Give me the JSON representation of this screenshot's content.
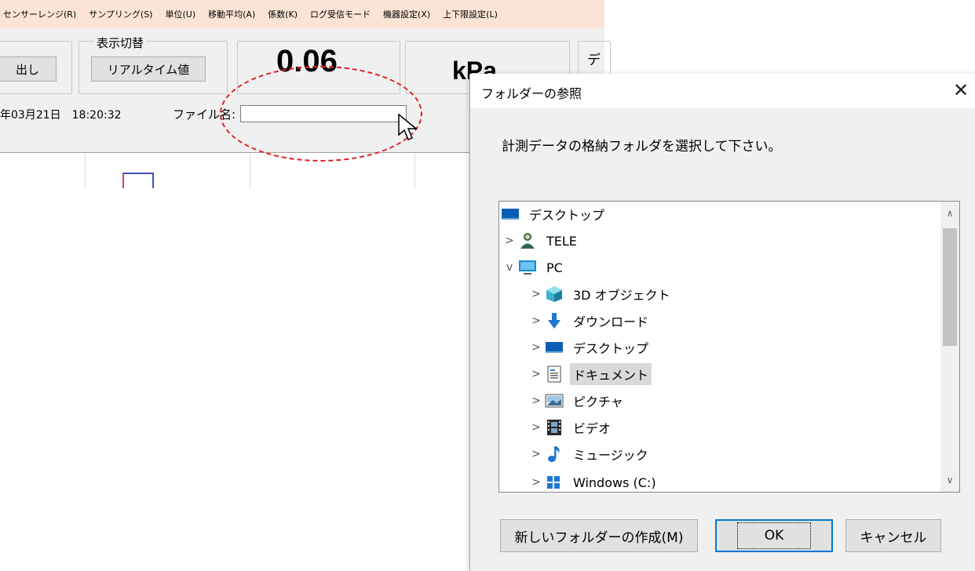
{
  "menu": [
    "センサーレンジ(R)",
    "サンプリング(S)",
    "単位(U)",
    "移動平均(A)",
    "係数(K)",
    "ログ受信モード",
    "機器設定(X)",
    "上下限設定(L)"
  ],
  "panel": {
    "read_button": "出し",
    "display_switch_label": "表示切替",
    "realtime_button": "リアルタイム値",
    "value": "0.06",
    "unit": "kPa",
    "side_label": "デ",
    "datetime": "年03月21日　18:20:32",
    "filename_label": "ファイル名:",
    "filename_value": ""
  },
  "dialog": {
    "title": "フォルダーの参照",
    "instruction": "計測データの格納フォルダを選択して下さい。",
    "tree": [
      {
        "label": "デスクトップ",
        "icon": "desktop-icon",
        "level": 0,
        "chevron": ""
      },
      {
        "label": "TELE",
        "icon": "user-icon",
        "level": 1,
        "chevron": ">"
      },
      {
        "label": "PC",
        "icon": "computer-icon",
        "level": 1,
        "chevron": "v"
      },
      {
        "label": "3D オブジェクト",
        "icon": "cube-icon",
        "level": 2,
        "chevron": ">"
      },
      {
        "label": "ダウンロード",
        "icon": "download-arrow-icon",
        "level": 2,
        "chevron": ">"
      },
      {
        "label": "デスクトップ",
        "icon": "desktop-icon",
        "level": 2,
        "chevron": ">"
      },
      {
        "label": "ドキュメント",
        "icon": "document-icon",
        "level": 2,
        "chevron": ">",
        "selected": true
      },
      {
        "label": "ピクチャ",
        "icon": "picture-icon",
        "level": 2,
        "chevron": ">"
      },
      {
        "label": "ビデオ",
        "icon": "video-icon",
        "level": 2,
        "chevron": ">"
      },
      {
        "label": "ミュージック",
        "icon": "music-note-icon",
        "level": 2,
        "chevron": ">"
      },
      {
        "label": "Windows (C:)",
        "icon": "drive-icon",
        "level": 2,
        "chevron": ">"
      }
    ],
    "buttons": {
      "new_folder": "新しいフォルダーの作成(M)",
      "ok": "OK",
      "cancel": "キャンセル"
    }
  },
  "colors": {
    "menubar": "#fbe4d5",
    "highlight_ellipse": "#e02020",
    "default_button_border": "#0078d7"
  }
}
